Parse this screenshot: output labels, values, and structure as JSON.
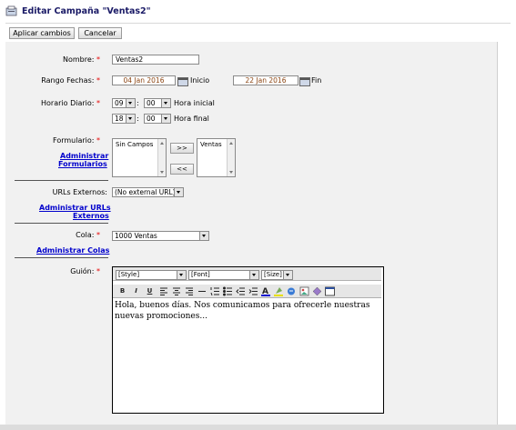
{
  "page": {
    "title": "Editar Campaña \"Ventas2\""
  },
  "toolbar": {
    "apply_label": "Aplicar cambios",
    "cancel_label": "Cancelar"
  },
  "form": {
    "nombre": {
      "label": "Nombre:",
      "value": "Ventas2"
    },
    "rango": {
      "label": "Rango Fechas:",
      "start": "04 Jan 2016",
      "start_label": "Inicio",
      "end": "22 Jan 2016",
      "end_label": "Fin"
    },
    "horario": {
      "label": "Horario Diario:",
      "start_h": "09",
      "start_m": "00",
      "start_label": "Hora inicial",
      "end_h": "18",
      "end_m": "00",
      "end_label": "Hora final",
      "sep": ":"
    },
    "formulario": {
      "label": "Formulario:",
      "available": [
        "Sin Campos"
      ],
      "selected": [
        "Ventas"
      ],
      "add": ">>",
      "remove": "<<",
      "admin_link_1": "Administrar",
      "admin_link_2": "Formularios"
    },
    "urls": {
      "label": "URLs Externos:",
      "value": "(No external URL)",
      "admin_link_1": "Administrar URLs",
      "admin_link_2": "Externos"
    },
    "cola": {
      "label": "Cola:",
      "value": "1000 Ventas",
      "admin_link": "Administrar Colas"
    },
    "guion": {
      "label": "Guión:",
      "style": "[Style]",
      "font": "[Font]",
      "size": "[Size]",
      "buttons": [
        "B",
        "I",
        "U"
      ],
      "text": "Hola, buenos días. Nos comunicamos para ofrecerle nuestras nuevas promociones..."
    },
    "required_mark": "*"
  },
  "colors": {
    "required": "#e60000",
    "link": "#0000cc",
    "date_text": "#8b4513",
    "form_bg": "#f1f1f1"
  }
}
